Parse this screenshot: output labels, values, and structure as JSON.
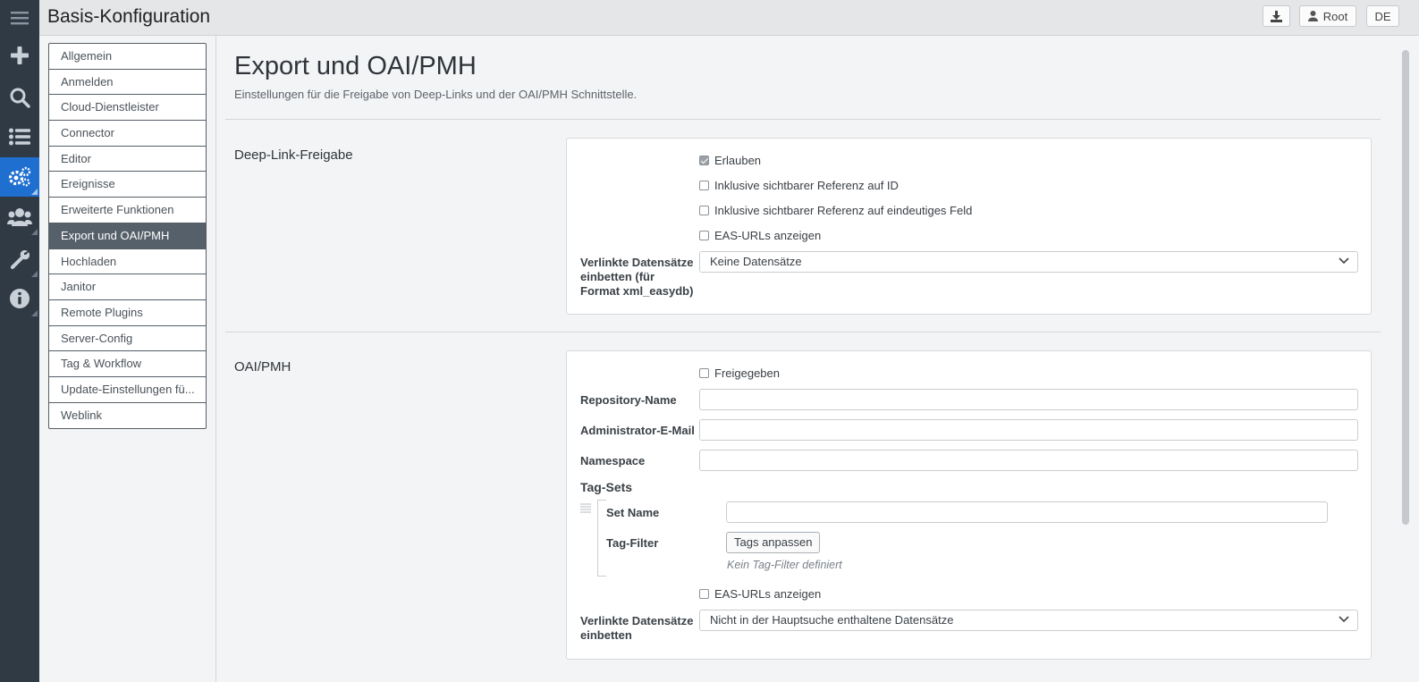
{
  "app": {
    "title": "Basis-Konfiguration"
  },
  "topbar": {
    "user_label": "Root",
    "lang_label": "DE"
  },
  "nav": {
    "items": [
      {
        "label": "Allgemein"
      },
      {
        "label": "Anmelden"
      },
      {
        "label": "Cloud-Dienstleister"
      },
      {
        "label": "Connector"
      },
      {
        "label": "Editor"
      },
      {
        "label": "Ereignisse"
      },
      {
        "label": "Erweiterte Funktionen"
      },
      {
        "label": "Export und OAI/PMH"
      },
      {
        "label": "Hochladen"
      },
      {
        "label": "Janitor"
      },
      {
        "label": "Remote Plugins"
      },
      {
        "label": "Server-Config"
      },
      {
        "label": "Tag & Workflow"
      },
      {
        "label": "Update-Einstellungen fü..."
      },
      {
        "label": "Weblink"
      }
    ],
    "active_index": 7
  },
  "page": {
    "title": "Export und OAI/PMH",
    "subtitle": "Einstellungen für die Freigabe von Deep-Links und der OAI/PMH Schnittstelle."
  },
  "deeplink": {
    "section_title": "Deep-Link-Freigabe",
    "allow_label": "Erlauben",
    "allow_checked": true,
    "ref_id_label": "Inklusive sichtbarer Referenz auf ID",
    "ref_id_checked": false,
    "ref_field_label": "Inklusive sichtbarer Referenz auf eindeutiges Feld",
    "ref_field_checked": false,
    "eas_label": "EAS-URLs anzeigen",
    "eas_checked": false,
    "embed_label": "Verlinkte Datensätze einbetten (für Format xml_easydb)",
    "embed_value": "Keine Datensätze"
  },
  "oai": {
    "section_title": "OAI/PMH",
    "enabled_label": "Freigegeben",
    "enabled_checked": false,
    "repo_name_label": "Repository-Name",
    "repo_name_value": "",
    "admin_email_label": "Administrator-E-Mail",
    "admin_email_value": "",
    "namespace_label": "Namespace",
    "namespace_value": "",
    "tagsets_label": "Tag-Sets",
    "set_name_label": "Set Name",
    "set_name_value": "",
    "tag_filter_label": "Tag-Filter",
    "tag_filter_button": "Tags anpassen",
    "tag_filter_empty": "Kein Tag-Filter definiert",
    "eas_label": "EAS-URLs anzeigen",
    "eas_checked": false,
    "embed_label": "Verlinkte Datensätze einbetten",
    "embed_value": "Nicht in der Hauptsuche enthaltene Datensätze"
  },
  "colors": {
    "rail_bg": "#2f3a45",
    "rail_active": "#1f6fd1",
    "nav_active": "#55606a"
  },
  "icons": {
    "rail": [
      "menu-icon",
      "plus-icon",
      "search-icon",
      "list-icon",
      "gears-icon",
      "users-icon",
      "wrench-icon",
      "info-icon"
    ],
    "topbar": [
      "download-icon",
      "user-icon"
    ]
  }
}
